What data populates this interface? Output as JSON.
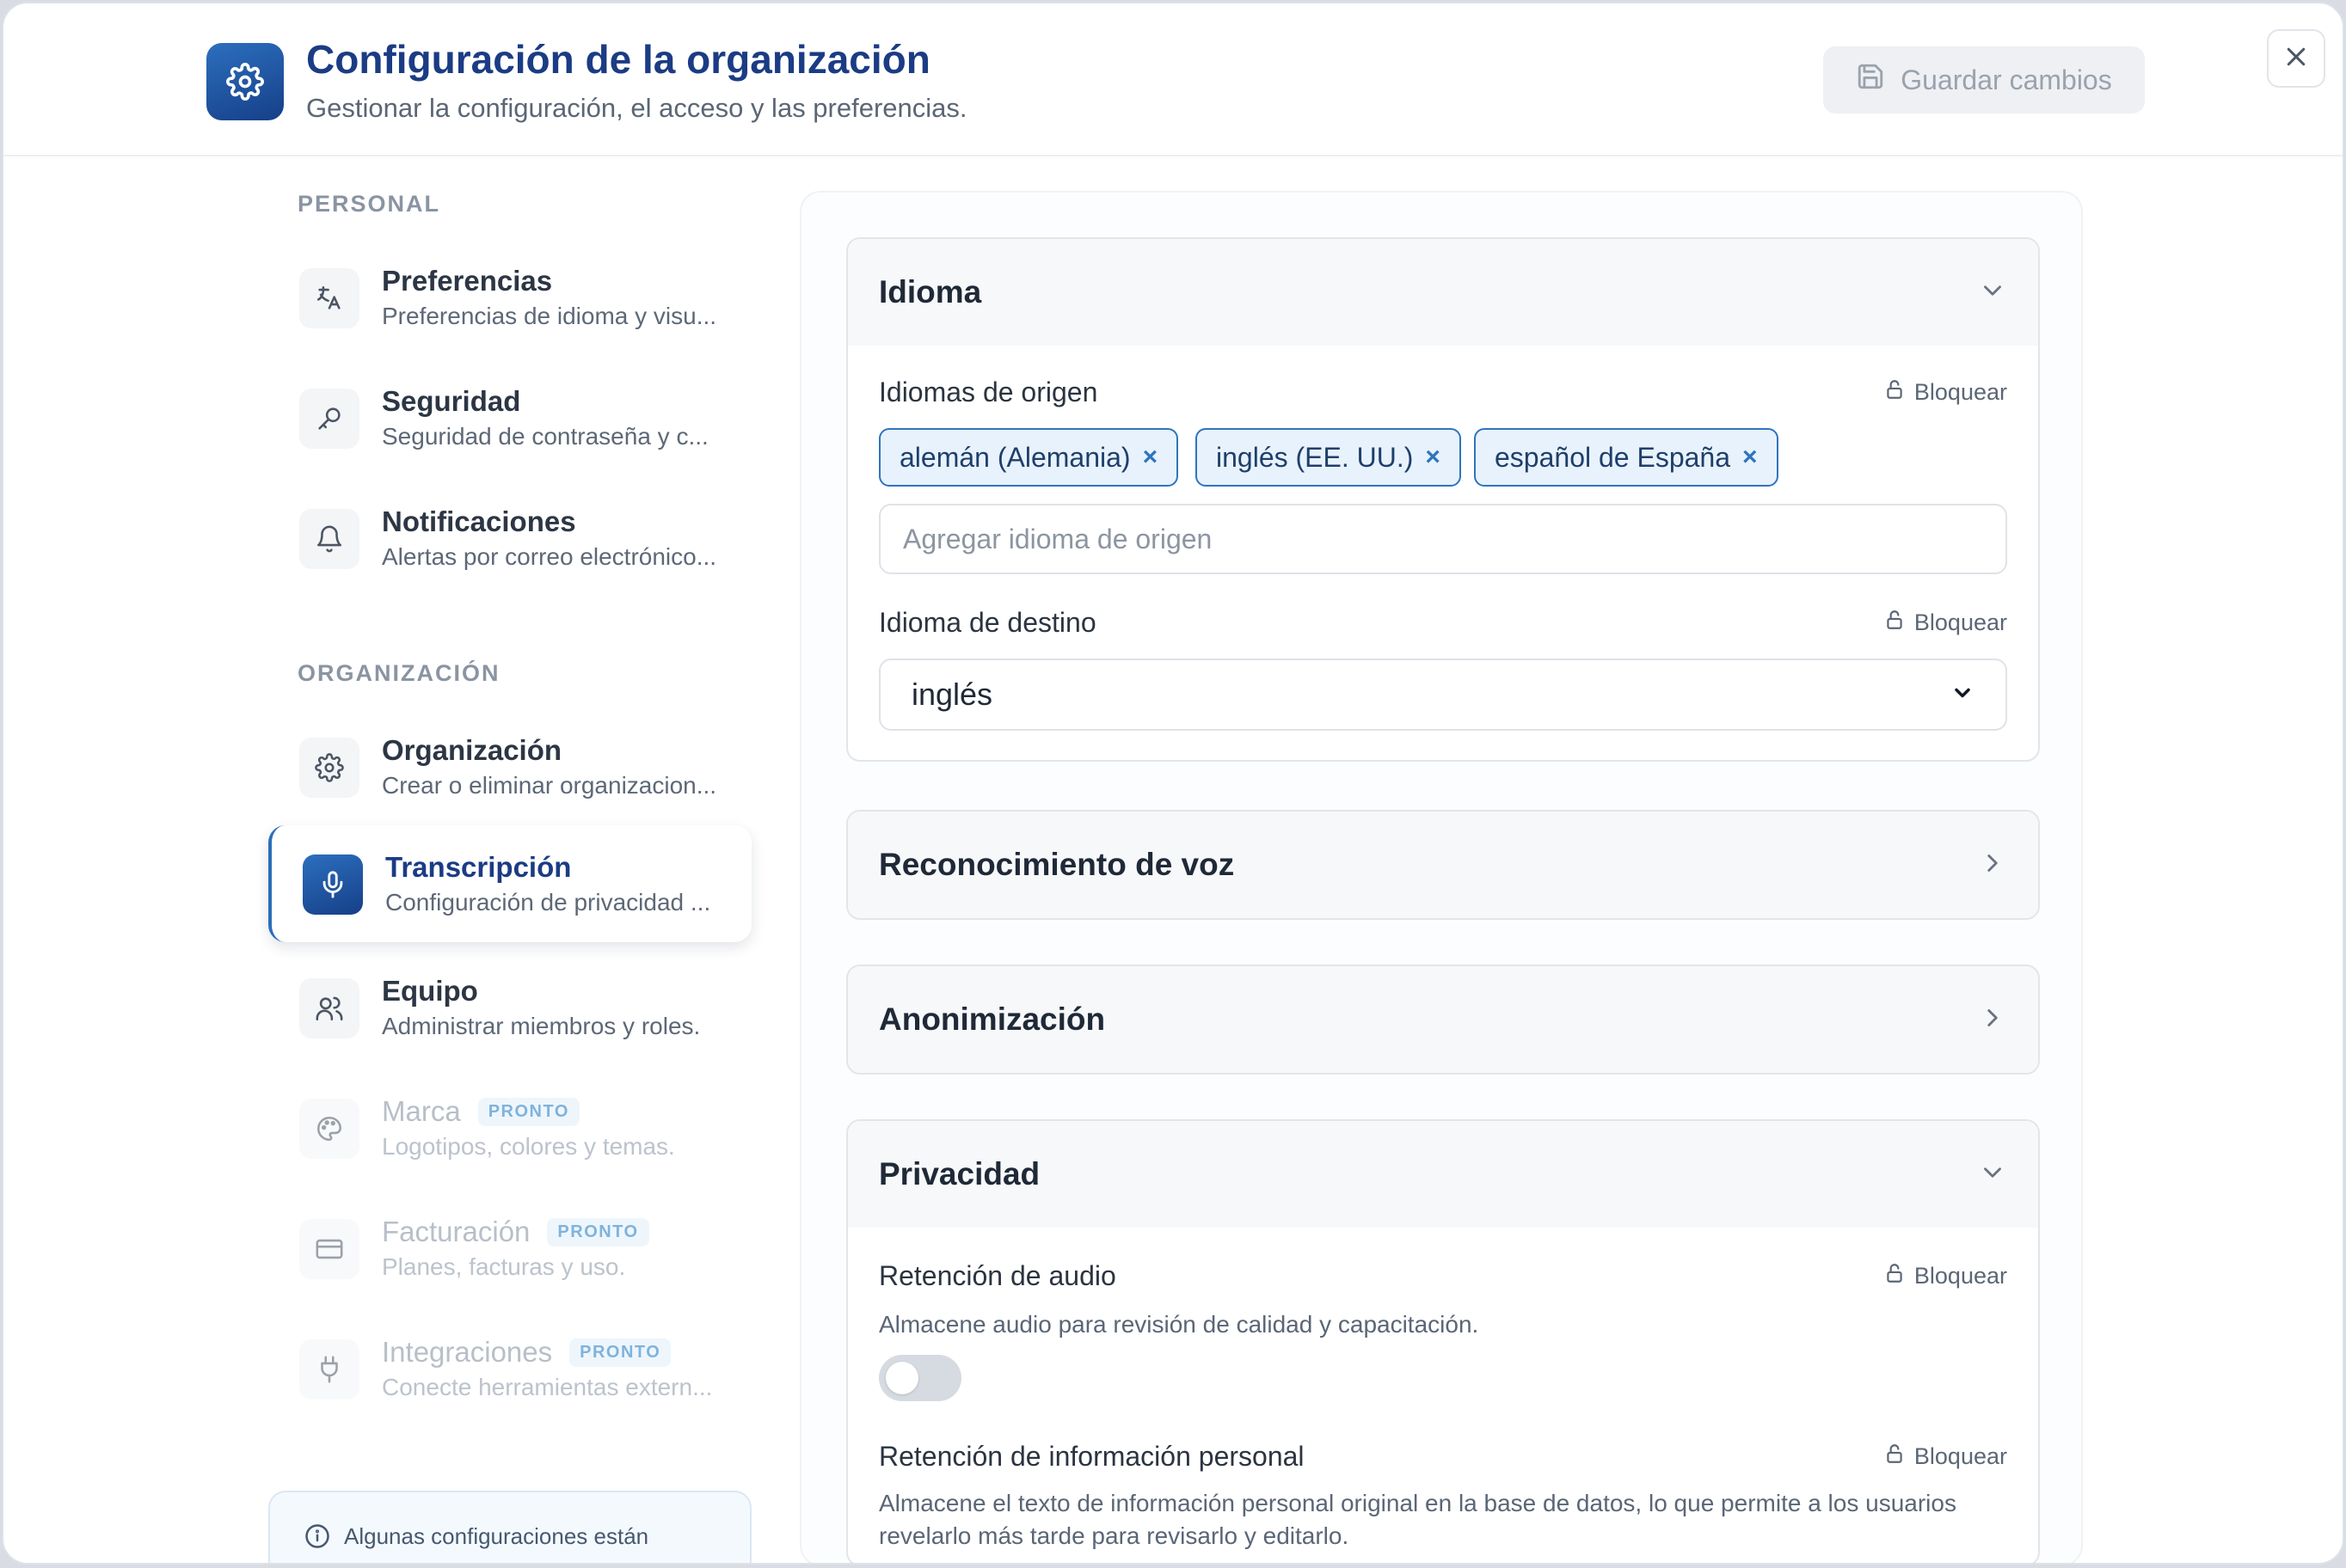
{
  "header": {
    "title": "Configuración de la organización",
    "subtitle": "Gestionar la configuración, el acceso y las preferencias.",
    "save_label": "Guardar cambios",
    "icon": "gear-icon"
  },
  "sidebar": {
    "personal_label": "PERSONAL",
    "organization_label": "ORGANIZACIÓN",
    "personal_items": [
      {
        "title": "Preferencias",
        "desc": "Preferencias de idioma y visu...",
        "icon": "translate-icon"
      },
      {
        "title": "Seguridad",
        "desc": "Seguridad de contraseña y c...",
        "icon": "key-icon"
      },
      {
        "title": "Notificaciones",
        "desc": "Alertas por correo electrónico...",
        "icon": "bell-icon"
      }
    ],
    "org_items": [
      {
        "title": "Organización",
        "desc": "Crear o eliminar organizacion...",
        "icon": "gear-icon"
      },
      {
        "title": "Transcripción",
        "desc": "Configuración de privacidad ...",
        "icon": "microphone-icon",
        "active": true
      },
      {
        "title": "Equipo",
        "desc": "Administrar miembros y roles.",
        "icon": "users-icon"
      },
      {
        "title": "Marca",
        "desc": "Logotipos, colores y temas.",
        "icon": "palette-icon",
        "badge": "PRONTO"
      },
      {
        "title": "Facturación",
        "desc": "Planes, facturas y uso.",
        "icon": "credit-card-icon",
        "badge": "PRONTO"
      },
      {
        "title": "Integraciones",
        "desc": "Conecte herramientas extern...",
        "icon": "plug-icon",
        "badge": "PRONTO"
      }
    ],
    "info_text": "Algunas configuraciones están"
  },
  "sections": {
    "idioma": {
      "title": "Idioma",
      "source_label": "Idiomas de origen",
      "lock_label": "Bloquear",
      "chips": [
        "alemán (Alemania)",
        "inglés (EE. UU.)",
        "español de España"
      ],
      "source_placeholder": "Agregar idioma de origen",
      "target_label": "Idioma de destino",
      "target_value": "inglés"
    },
    "voz": {
      "title": "Reconocimiento de voz"
    },
    "anon": {
      "title": "Anonimización"
    },
    "privacidad": {
      "title": "Privacidad",
      "audio_label": "Retención de audio",
      "audio_help": "Almacene audio para revisión de calidad y capacitación.",
      "audio_enabled": false,
      "pii_label": "Retención de información personal",
      "pii_help": "Almacene el texto de información personal original en la base de datos, lo que permite a los usuarios revelarlo más tarde para revisarlo y editarlo."
    }
  },
  "colors": {
    "accent": "#1b3c84",
    "chip_border": "#2f74bd",
    "chip_bg": "#e8f2fc"
  }
}
